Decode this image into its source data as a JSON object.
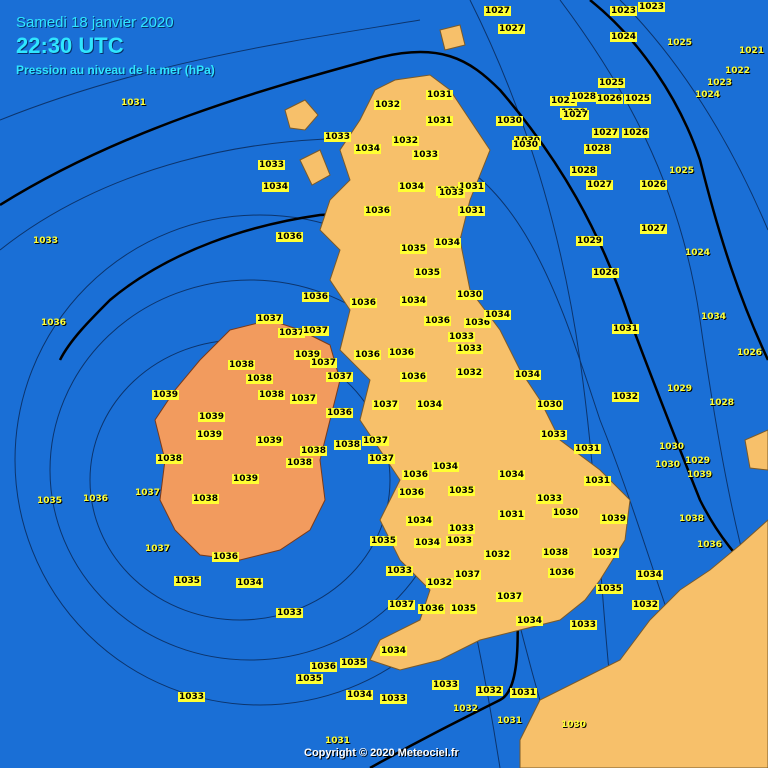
{
  "header": {
    "date": "Samedi 18 janvier 2020",
    "time": "22:30 UTC",
    "subtitle": "Pression au niveau de la mer (hPa)"
  },
  "copyright": "Copyright © 2020 Meteociel.fr",
  "colors": {
    "sea": "#1a6fd6",
    "land": "#f7c06a",
    "ireland": "#f29b5e",
    "continent": "#f7c06a",
    "isobar": "#000000",
    "value_label": "#ffff33"
  },
  "pressure_values": [
    {
      "v": "1027"
    },
    {
      "v": "1027"
    },
    {
      "v": "1023"
    },
    {
      "v": "1023"
    },
    {
      "v": "1028"
    },
    {
      "v": "1029"
    },
    {
      "v": "1030"
    },
    {
      "v": "1031"
    },
    {
      "v": "1024"
    },
    {
      "v": "1025"
    },
    {
      "v": "1021"
    },
    {
      "v": "1022"
    },
    {
      "v": "1023"
    },
    {
      "v": "1024"
    },
    {
      "v": "1031"
    },
    {
      "v": "1032"
    },
    {
      "v": "1031"
    },
    {
      "v": "1030"
    },
    {
      "v": "1025"
    },
    {
      "v": "1026"
    },
    {
      "v": "1025"
    },
    {
      "v": "1028"
    },
    {
      "v": "1027"
    },
    {
      "v": "1033"
    },
    {
      "v": "1033"
    },
    {
      "v": "1032"
    },
    {
      "v": "1034"
    },
    {
      "v": "1033"
    },
    {
      "v": "1030"
    },
    {
      "v": "1028"
    },
    {
      "v": "1027"
    },
    {
      "v": "1026"
    },
    {
      "v": "1025"
    },
    {
      "v": "1033"
    },
    {
      "v": "1034"
    },
    {
      "v": "1031"
    },
    {
      "v": "1036"
    },
    {
      "v": "1033"
    },
    {
      "v": "1031"
    },
    {
      "v": "1028"
    },
    {
      "v": "1027"
    },
    {
      "v": "1026"
    },
    {
      "v": "1034"
    },
    {
      "v": "1036"
    },
    {
      "v": "1035"
    },
    {
      "v": "1035"
    },
    {
      "v": "1034"
    },
    {
      "v": "1029"
    },
    {
      "v": "1027"
    },
    {
      "v": "1024"
    },
    {
      "v": "1033"
    },
    {
      "v": "1036"
    },
    {
      "v": "1036"
    },
    {
      "v": "1034"
    },
    {
      "v": "1030"
    },
    {
      "v": "1026"
    },
    {
      "v": "1034"
    },
    {
      "v": "1036"
    },
    {
      "v": "1036"
    },
    {
      "v": "1036"
    },
    {
      "v": "1034"
    },
    {
      "v": "1031"
    },
    {
      "v": "1026"
    },
    {
      "v": "1037"
    },
    {
      "v": "1037"
    },
    {
      "v": "1037"
    },
    {
      "v": "1036"
    },
    {
      "v": "1034"
    },
    {
      "v": "1029"
    },
    {
      "v": "1038"
    },
    {
      "v": "1038"
    },
    {
      "v": "1039"
    },
    {
      "v": "1037"
    },
    {
      "v": "1037"
    },
    {
      "v": "1036"
    },
    {
      "v": "1033"
    },
    {
      "v": "1032"
    },
    {
      "v": "1028"
    },
    {
      "v": "1039"
    },
    {
      "v": "1039"
    },
    {
      "v": "1038"
    },
    {
      "v": "1037"
    },
    {
      "v": "1036"
    },
    {
      "v": "1034"
    },
    {
      "v": "1033"
    },
    {
      "v": "1032"
    },
    {
      "v": "1030"
    },
    {
      "v": "1036"
    },
    {
      "v": "1037"
    },
    {
      "v": "1038"
    },
    {
      "v": "1039"
    },
    {
      "v": "1039"
    },
    {
      "v": "1038"
    },
    {
      "v": "1037"
    },
    {
      "v": "1036"
    },
    {
      "v": "1034"
    },
    {
      "v": "1033"
    },
    {
      "v": "1031"
    },
    {
      "v": "1030"
    },
    {
      "v": "1029"
    },
    {
      "v": "1038"
    },
    {
      "v": "1039"
    },
    {
      "v": "1038"
    },
    {
      "v": "1037"
    },
    {
      "v": "1036"
    },
    {
      "v": "1035"
    },
    {
      "v": "1034"
    },
    {
      "v": "1033"
    },
    {
      "v": "1031"
    },
    {
      "v": "1030"
    },
    {
      "v": "1039"
    },
    {
      "v": "1038"
    },
    {
      "v": "1037"
    },
    {
      "v": "1036"
    },
    {
      "v": "1035"
    },
    {
      "v": "1034"
    },
    {
      "v": "1033"
    },
    {
      "v": "1031"
    },
    {
      "v": "1030"
    },
    {
      "v": "1039"
    },
    {
      "v": "1038"
    },
    {
      "v": "1037"
    },
    {
      "v": "1036"
    },
    {
      "v": "1035"
    },
    {
      "v": "1034"
    },
    {
      "v": "1033"
    },
    {
      "v": "1032"
    },
    {
      "v": "1038"
    },
    {
      "v": "1037"
    },
    {
      "v": "1036"
    },
    {
      "v": "1035"
    },
    {
      "v": "1034"
    },
    {
      "v": "1033"
    },
    {
      "v": "1032"
    },
    {
      "v": "1037"
    },
    {
      "v": "1037"
    },
    {
      "v": "1036"
    },
    {
      "v": "1035"
    },
    {
      "v": "1034"
    },
    {
      "v": "1033"
    },
    {
      "v": "1037"
    },
    {
      "v": "1036"
    },
    {
      "v": "1035"
    },
    {
      "v": "1034"
    },
    {
      "v": "1033"
    },
    {
      "v": "1032"
    },
    {
      "v": "1036"
    },
    {
      "v": "1035"
    },
    {
      "v": "1034"
    },
    {
      "v": "1033"
    },
    {
      "v": "1032"
    },
    {
      "v": "1031"
    },
    {
      "v": "1035"
    },
    {
      "v": "1034"
    },
    {
      "v": "1033"
    },
    {
      "v": "1032"
    },
    {
      "v": "1031"
    },
    {
      "v": "1030"
    },
    {
      "v": "1033"
    },
    {
      "v": "1031"
    }
  ]
}
